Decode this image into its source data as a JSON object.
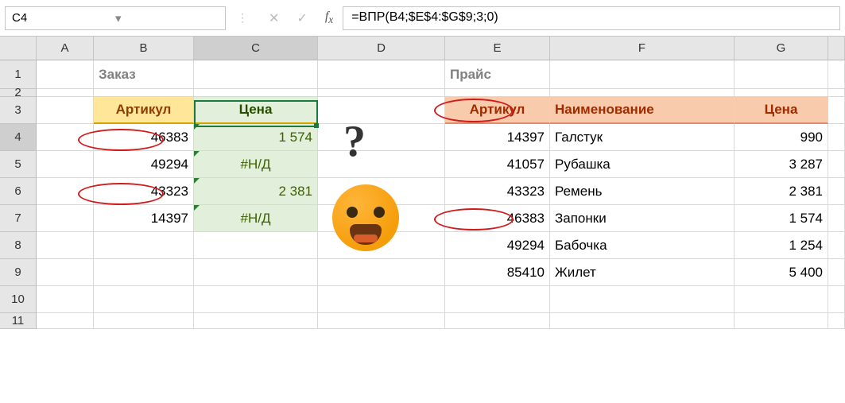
{
  "nameBox": "C4",
  "formula": "=ВПР(B4;$E$4:$G$9;3;0)",
  "cols": [
    "A",
    "B",
    "C",
    "D",
    "E",
    "F",
    "G",
    ""
  ],
  "rows": [
    "1",
    "2",
    "3",
    "4",
    "5",
    "6",
    "7",
    "8",
    "9",
    "10",
    "11"
  ],
  "labels": {
    "zakaz": "Заказ",
    "prais": "Прайс"
  },
  "t1": {
    "h": [
      "Артикул",
      "Цена"
    ],
    "r": [
      {
        "art": "46383",
        "price": "1 574"
      },
      {
        "art": "49294",
        "price": "#Н/Д"
      },
      {
        "art": "43323",
        "price": "2 381"
      },
      {
        "art": "14397",
        "price": "#Н/Д"
      }
    ]
  },
  "t2": {
    "h": [
      "Артикул",
      "Наименование",
      "Цена"
    ],
    "r": [
      {
        "art": "14397",
        "name": "Галстук",
        "price": "990"
      },
      {
        "art": "41057",
        "name": "Рубашка",
        "price": "3 287"
      },
      {
        "art": "43323",
        "name": "Ремень",
        "price": "2 381"
      },
      {
        "art": "46383",
        "name": "Запонки",
        "price": "1 574"
      },
      {
        "art": "49294",
        "name": "Бабочка",
        "price": "1 254"
      },
      {
        "art": "85410",
        "name": "Жилет",
        "price": "5 400"
      }
    ]
  },
  "q": "?",
  "chart_data": null
}
